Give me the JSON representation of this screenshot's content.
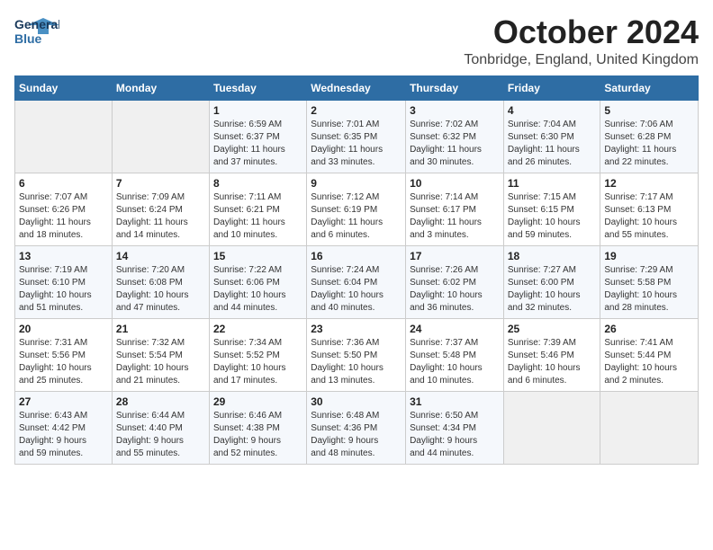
{
  "header": {
    "logo_general": "General",
    "logo_blue": "Blue",
    "month_title": "October 2024",
    "location": "Tonbridge, England, United Kingdom"
  },
  "days_of_week": [
    "Sunday",
    "Monday",
    "Tuesday",
    "Wednesday",
    "Thursday",
    "Friday",
    "Saturday"
  ],
  "weeks": [
    [
      {
        "day": "",
        "info": ""
      },
      {
        "day": "",
        "info": ""
      },
      {
        "day": "1",
        "info": "Sunrise: 6:59 AM\nSunset: 6:37 PM\nDaylight: 11 hours\nand 37 minutes."
      },
      {
        "day": "2",
        "info": "Sunrise: 7:01 AM\nSunset: 6:35 PM\nDaylight: 11 hours\nand 33 minutes."
      },
      {
        "day": "3",
        "info": "Sunrise: 7:02 AM\nSunset: 6:32 PM\nDaylight: 11 hours\nand 30 minutes."
      },
      {
        "day": "4",
        "info": "Sunrise: 7:04 AM\nSunset: 6:30 PM\nDaylight: 11 hours\nand 26 minutes."
      },
      {
        "day": "5",
        "info": "Sunrise: 7:06 AM\nSunset: 6:28 PM\nDaylight: 11 hours\nand 22 minutes."
      }
    ],
    [
      {
        "day": "6",
        "info": "Sunrise: 7:07 AM\nSunset: 6:26 PM\nDaylight: 11 hours\nand 18 minutes."
      },
      {
        "day": "7",
        "info": "Sunrise: 7:09 AM\nSunset: 6:24 PM\nDaylight: 11 hours\nand 14 minutes."
      },
      {
        "day": "8",
        "info": "Sunrise: 7:11 AM\nSunset: 6:21 PM\nDaylight: 11 hours\nand 10 minutes."
      },
      {
        "day": "9",
        "info": "Sunrise: 7:12 AM\nSunset: 6:19 PM\nDaylight: 11 hours\nand 6 minutes."
      },
      {
        "day": "10",
        "info": "Sunrise: 7:14 AM\nSunset: 6:17 PM\nDaylight: 11 hours\nand 3 minutes."
      },
      {
        "day": "11",
        "info": "Sunrise: 7:15 AM\nSunset: 6:15 PM\nDaylight: 10 hours\nand 59 minutes."
      },
      {
        "day": "12",
        "info": "Sunrise: 7:17 AM\nSunset: 6:13 PM\nDaylight: 10 hours\nand 55 minutes."
      }
    ],
    [
      {
        "day": "13",
        "info": "Sunrise: 7:19 AM\nSunset: 6:10 PM\nDaylight: 10 hours\nand 51 minutes."
      },
      {
        "day": "14",
        "info": "Sunrise: 7:20 AM\nSunset: 6:08 PM\nDaylight: 10 hours\nand 47 minutes."
      },
      {
        "day": "15",
        "info": "Sunrise: 7:22 AM\nSunset: 6:06 PM\nDaylight: 10 hours\nand 44 minutes."
      },
      {
        "day": "16",
        "info": "Sunrise: 7:24 AM\nSunset: 6:04 PM\nDaylight: 10 hours\nand 40 minutes."
      },
      {
        "day": "17",
        "info": "Sunrise: 7:26 AM\nSunset: 6:02 PM\nDaylight: 10 hours\nand 36 minutes."
      },
      {
        "day": "18",
        "info": "Sunrise: 7:27 AM\nSunset: 6:00 PM\nDaylight: 10 hours\nand 32 minutes."
      },
      {
        "day": "19",
        "info": "Sunrise: 7:29 AM\nSunset: 5:58 PM\nDaylight: 10 hours\nand 28 minutes."
      }
    ],
    [
      {
        "day": "20",
        "info": "Sunrise: 7:31 AM\nSunset: 5:56 PM\nDaylight: 10 hours\nand 25 minutes."
      },
      {
        "day": "21",
        "info": "Sunrise: 7:32 AM\nSunset: 5:54 PM\nDaylight: 10 hours\nand 21 minutes."
      },
      {
        "day": "22",
        "info": "Sunrise: 7:34 AM\nSunset: 5:52 PM\nDaylight: 10 hours\nand 17 minutes."
      },
      {
        "day": "23",
        "info": "Sunrise: 7:36 AM\nSunset: 5:50 PM\nDaylight: 10 hours\nand 13 minutes."
      },
      {
        "day": "24",
        "info": "Sunrise: 7:37 AM\nSunset: 5:48 PM\nDaylight: 10 hours\nand 10 minutes."
      },
      {
        "day": "25",
        "info": "Sunrise: 7:39 AM\nSunset: 5:46 PM\nDaylight: 10 hours\nand 6 minutes."
      },
      {
        "day": "26",
        "info": "Sunrise: 7:41 AM\nSunset: 5:44 PM\nDaylight: 10 hours\nand 2 minutes."
      }
    ],
    [
      {
        "day": "27",
        "info": "Sunrise: 6:43 AM\nSunset: 4:42 PM\nDaylight: 9 hours\nand 59 minutes."
      },
      {
        "day": "28",
        "info": "Sunrise: 6:44 AM\nSunset: 4:40 PM\nDaylight: 9 hours\nand 55 minutes."
      },
      {
        "day": "29",
        "info": "Sunrise: 6:46 AM\nSunset: 4:38 PM\nDaylight: 9 hours\nand 52 minutes."
      },
      {
        "day": "30",
        "info": "Sunrise: 6:48 AM\nSunset: 4:36 PM\nDaylight: 9 hours\nand 48 minutes."
      },
      {
        "day": "31",
        "info": "Sunrise: 6:50 AM\nSunset: 4:34 PM\nDaylight: 9 hours\nand 44 minutes."
      },
      {
        "day": "",
        "info": ""
      },
      {
        "day": "",
        "info": ""
      }
    ]
  ]
}
